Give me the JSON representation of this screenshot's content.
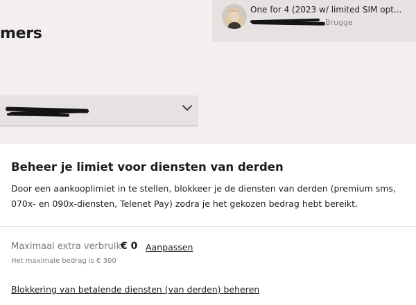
{
  "header": {
    "title_fragment": "mers"
  },
  "account_card": {
    "title": "One for 4 (2023 w/ limited SIM opt...",
    "subtitle_visible_fragment": "Brugge",
    "avatar_icon": "user-avatar-photo"
  },
  "selector": {
    "icon": "chevron-down-icon"
  },
  "section": {
    "title": "Beheer je limiet voor diensten van derden",
    "description": "Door een aankooplimiet in te stellen, blokkeer je de diensten van derden (premium sms, 070x- en 090x-diensten, Telenet Pay) zodra je het gekozen bedrag hebt bereikt."
  },
  "limit": {
    "label": "Maximaal extra verbruik",
    "value": "€ 0",
    "adjust_label": "Aanpassen",
    "hint": "Het maximale bedrag is € 300"
  },
  "links": {
    "manage_blocking": "Blokkering van betalende diensten (van derden) beheren"
  },
  "colors": {
    "background_top": "#f3efee",
    "card_background": "#e6e2e1",
    "text_primary": "#1b1b1b",
    "text_muted": "#7e7a77"
  }
}
